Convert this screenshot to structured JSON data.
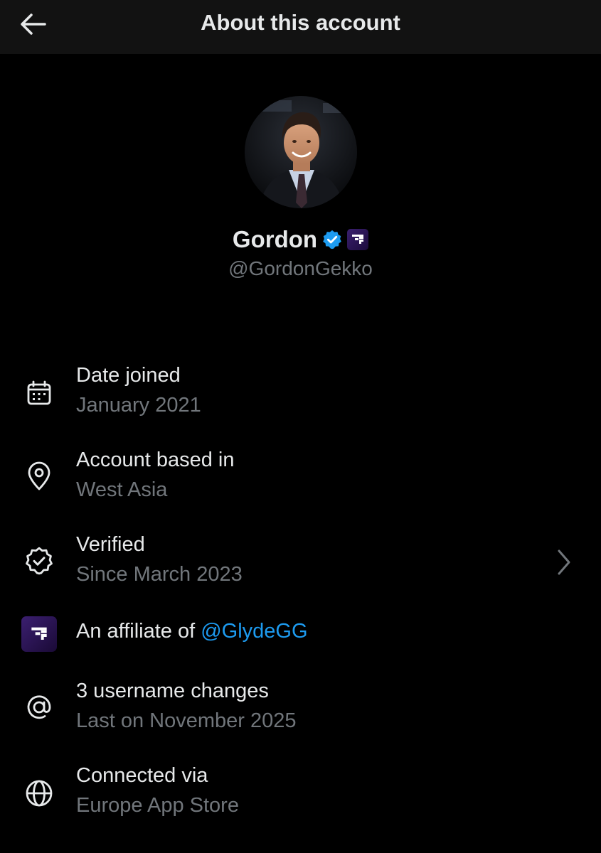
{
  "header": {
    "title": "About this account"
  },
  "profile": {
    "display_name": "Gordon",
    "handle": "@GordonGekko"
  },
  "details": {
    "date_joined": {
      "label": "Date joined",
      "value": "January 2021"
    },
    "based_in": {
      "label": "Account based in",
      "value": "West Asia"
    },
    "verified": {
      "label": "Verified",
      "value": "Since March 2023"
    },
    "affiliate": {
      "prefix": "An affiliate of ",
      "link": "@GlydeGG"
    },
    "username_changes": {
      "label": "3 username changes",
      "value": "Last on November 2025"
    },
    "connected_via": {
      "label": "Connected via",
      "value": "Europe App Store"
    }
  },
  "icons": {
    "back": "arrow-left-icon",
    "date_joined": "calendar-icon",
    "based_in": "location-pin-icon",
    "verified": "verified-check-icon",
    "affiliate": "affiliate-logo-icon",
    "username_changes": "at-sign-icon",
    "connected_via": "globe-icon",
    "chevron": "chevron-right-icon"
  },
  "colors": {
    "background": "#000000",
    "header_background": "#121212",
    "primary_text": "#e7e9ea",
    "secondary_text": "#71767b",
    "link": "#1d9bf0",
    "verified_badge": "#1d9bf0",
    "affiliate_badge": "#3b1f70"
  }
}
